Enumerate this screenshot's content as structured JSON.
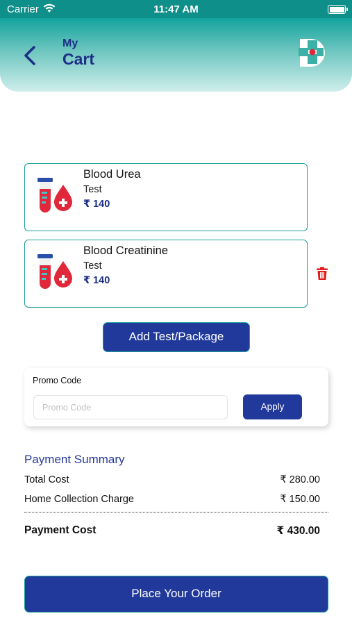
{
  "status_bar": {
    "carrier": "Carrier",
    "time": "11:47 AM"
  },
  "header": {
    "title_small": "My",
    "title_big": "Cart"
  },
  "cart": {
    "items": [
      {
        "name": "Blood Urea",
        "type": "Test",
        "price": "₹ 140"
      },
      {
        "name": "Blood Creatinine",
        "type": "Test",
        "price": "₹ 140"
      }
    ]
  },
  "add_button": {
    "label": "Add Test/Package"
  },
  "promo": {
    "label": "Promo Code",
    "placeholder": "Promo Code",
    "value": "",
    "apply_label": "Apply"
  },
  "payment_summary": {
    "title": "Payment Summary",
    "rows": [
      {
        "label": "Total Cost",
        "value": "₹ 280.00"
      },
      {
        "label": "Home Collection Charge",
        "value": "₹ 150.00"
      }
    ],
    "total_label": "Payment Cost",
    "total_value": "₹ 430.00"
  },
  "order_button": {
    "label": "Place Your Order"
  },
  "colors": {
    "teal": "#12a39c",
    "navy": "#21399a",
    "red": "#e0283a"
  },
  "icons": [
    "wifi-icon",
    "battery-icon",
    "back-arrow-icon",
    "app-logo",
    "blood-test-icon",
    "trash-icon"
  ]
}
